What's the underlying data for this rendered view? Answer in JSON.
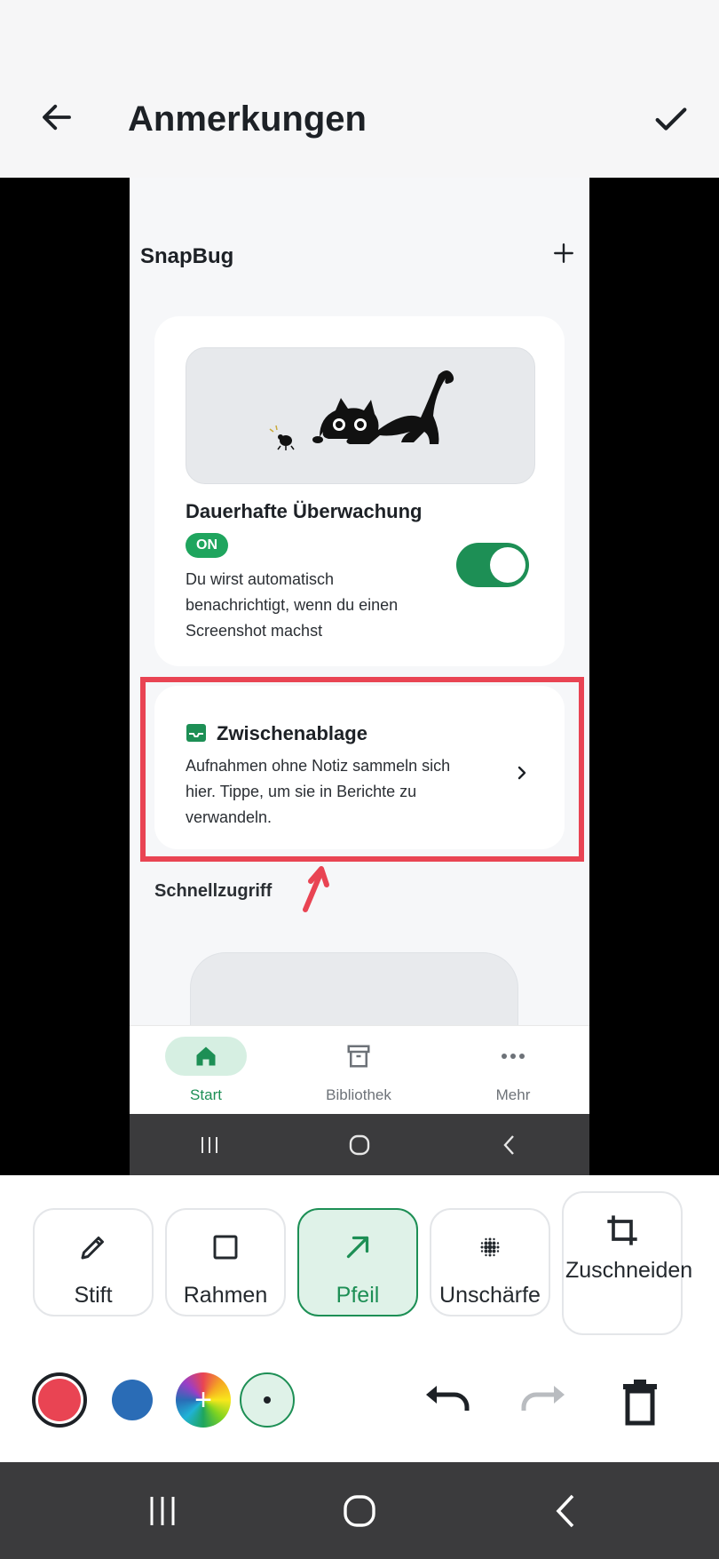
{
  "header": {
    "title": "Anmerkungen"
  },
  "screenshot": {
    "app_title": "SnapBug",
    "monitor_card": {
      "title": "Dauerhafte Überwachung",
      "badge": "ON",
      "description": "Du wirst automatisch benachrichtigt, wenn du einen Screenshot machst",
      "toggle_on": true
    },
    "clipboard_card": {
      "title": "Zwischenablage",
      "description": "Aufnahmen ohne Notiz sammeln sich hier. Tippe, um sie in Berichte zu verwandeln."
    },
    "quick_access_label": "Schnellzugriff",
    "nav": [
      {
        "label": "Start",
        "icon": "home-icon",
        "active": true
      },
      {
        "label": "Bibliothek",
        "icon": "archive-icon",
        "active": false
      },
      {
        "label": "Mehr",
        "icon": "more-dots-icon",
        "active": false
      }
    ]
  },
  "tools": [
    {
      "label": "Stift",
      "icon": "pencil-icon",
      "active": false
    },
    {
      "label": "Rahmen",
      "icon": "square-icon",
      "active": false
    },
    {
      "label": "Pfeil",
      "icon": "arrow-icon",
      "active": true
    },
    {
      "label": "Unschärfe",
      "icon": "blur-icon",
      "active": false
    },
    {
      "label": "Zuschneiden",
      "icon": "crop-icon",
      "active": false
    }
  ],
  "colors": {
    "selected": "#e94453",
    "options": [
      "#e94453",
      "#2a6cb6"
    ],
    "accent": "#1d8f55",
    "annotation": "#e94453"
  }
}
